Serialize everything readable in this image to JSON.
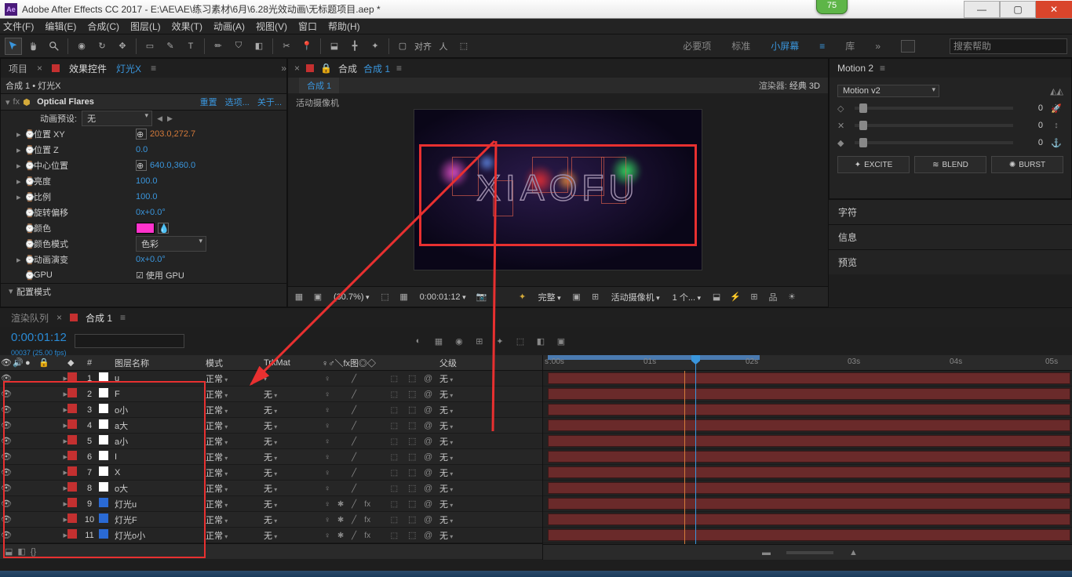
{
  "title": "Adobe After Effects CC 2017 - E:\\AE\\AE\\练习素材\\6月\\6.28光效动画\\无标题项目.aep *",
  "badge": "75",
  "menu": [
    "文件(F)",
    "编辑(E)",
    "合成(C)",
    "图层(L)",
    "效果(T)",
    "动画(A)",
    "视图(V)",
    "窗口",
    "帮助(H)"
  ],
  "workspaces": {
    "items": [
      "必要项",
      "标准",
      "小屏幕",
      "库"
    ],
    "active": 2,
    "search_ph": "搜索帮助"
  },
  "snap_label": "对齐",
  "fx": {
    "tab_project": "项目",
    "tab_fx": "效果控件",
    "tab_fx_suffix": "灯光X",
    "breadcrumb": "合成 1 • 灯光X",
    "effect_name": "Optical Flares",
    "links": {
      "reset": "重置",
      "options": "选项...",
      "about": "关于..."
    },
    "preset_label": "动画预设:",
    "preset_value": "无",
    "props": [
      {
        "tw": "▸",
        "sw": "⌚",
        "name": "位置 XY",
        "val_box": true,
        "val": "203.0,272.7",
        "red": true
      },
      {
        "tw": "▸",
        "sw": "⌚",
        "name": "位置 Z",
        "val": "0.0"
      },
      {
        "tw": "▸",
        "sw": "⌚",
        "name": "中心位置",
        "val_box": true,
        "val": "640.0,360.0"
      },
      {
        "tw": "▸",
        "sw": "⌚",
        "name": "亮度",
        "val": "100.0"
      },
      {
        "tw": "▸",
        "sw": "⌚",
        "name": "比例",
        "val": "100.0"
      },
      {
        "tw": "",
        "sw": "⌚",
        "name": "旋转偏移",
        "val": "0x+0.0°"
      },
      {
        "tw": "",
        "sw": "⌚",
        "name": "颜色",
        "color": true
      },
      {
        "tw": "",
        "sw": "⌚",
        "name": "颜色模式",
        "dd": "色彩"
      },
      {
        "tw": "▸",
        "sw": "⌚",
        "name": "动画演变",
        "val": "0x+0.0°"
      },
      {
        "tw": "",
        "sw": "⌚",
        "name": "GPU",
        "chk": true,
        "chk_label": "使用 GPU"
      }
    ],
    "footer": "配置模式"
  },
  "viewer": {
    "tab_comp_label": "合成",
    "tab_comp_name": "合成 1",
    "sub_comp": "合成 1",
    "renderer_label": "渲染器:",
    "renderer_value": "经典 3D",
    "camera": "活动摄像机",
    "neon": "XIAOFU",
    "foot": {
      "zoom": "(30.7%)",
      "time": "0:00:01:12",
      "res": "完整",
      "cam": "活动摄像机",
      "views": "1 个..."
    }
  },
  "motion": {
    "title": "Motion 2",
    "preset": "Motion v2",
    "sliders": [
      {
        "icon": "◇",
        "val": "0"
      },
      {
        "icon": "✕",
        "val": "0"
      },
      {
        "icon": "◆",
        "val": "0"
      }
    ],
    "btns": [
      "EXCITE",
      "BLEND",
      "BURST"
    ],
    "stack": [
      "字符",
      "信息",
      "预览"
    ]
  },
  "timeline": {
    "tab_render": "渲染队列",
    "tab_comp": "合成 1",
    "time": "0:00:01:12",
    "time_sub": "00037 (25.00 fps)",
    "cols": {
      "num": "#",
      "name": "图层名称",
      "mode": "模式",
      "trk": "TrkMat",
      "switches": "♀♂＼fx图◎◇",
      "parent": "父级"
    },
    "ruler": [
      "s",
      ":00s",
      "01s",
      "02s",
      "03s",
      "04s",
      "05s"
    ],
    "layers": [
      {
        "n": 1,
        "name": "u",
        "sw": "w",
        "mode": "正常",
        "trk": "",
        "fx": false
      },
      {
        "n": 2,
        "name": "F",
        "sw": "w",
        "mode": "正常",
        "trk": "无",
        "fx": false
      },
      {
        "n": 3,
        "name": "o小",
        "sw": "w",
        "mode": "正常",
        "trk": "无",
        "fx": false
      },
      {
        "n": 4,
        "name": "a大",
        "sw": "w",
        "mode": "正常",
        "trk": "无",
        "fx": false
      },
      {
        "n": 5,
        "name": "a小",
        "sw": "w",
        "mode": "正常",
        "trk": "无",
        "fx": false
      },
      {
        "n": 6,
        "name": "I",
        "sw": "w",
        "mode": "正常",
        "trk": "无",
        "fx": false
      },
      {
        "n": 7,
        "name": "X",
        "sw": "w",
        "mode": "正常",
        "trk": "无",
        "fx": false
      },
      {
        "n": 8,
        "name": "o大",
        "sw": "w",
        "mode": "正常",
        "trk": "无",
        "fx": false
      },
      {
        "n": 9,
        "name": "灯光u",
        "sw": "b",
        "mode": "正常",
        "trk": "无",
        "fx": true
      },
      {
        "n": 10,
        "name": "灯光F",
        "sw": "b",
        "mode": "正常",
        "trk": "无",
        "fx": true
      },
      {
        "n": 11,
        "name": "灯光o小",
        "sw": "b",
        "mode": "正常",
        "trk": "无",
        "fx": true
      }
    ],
    "parent_none": "无"
  }
}
